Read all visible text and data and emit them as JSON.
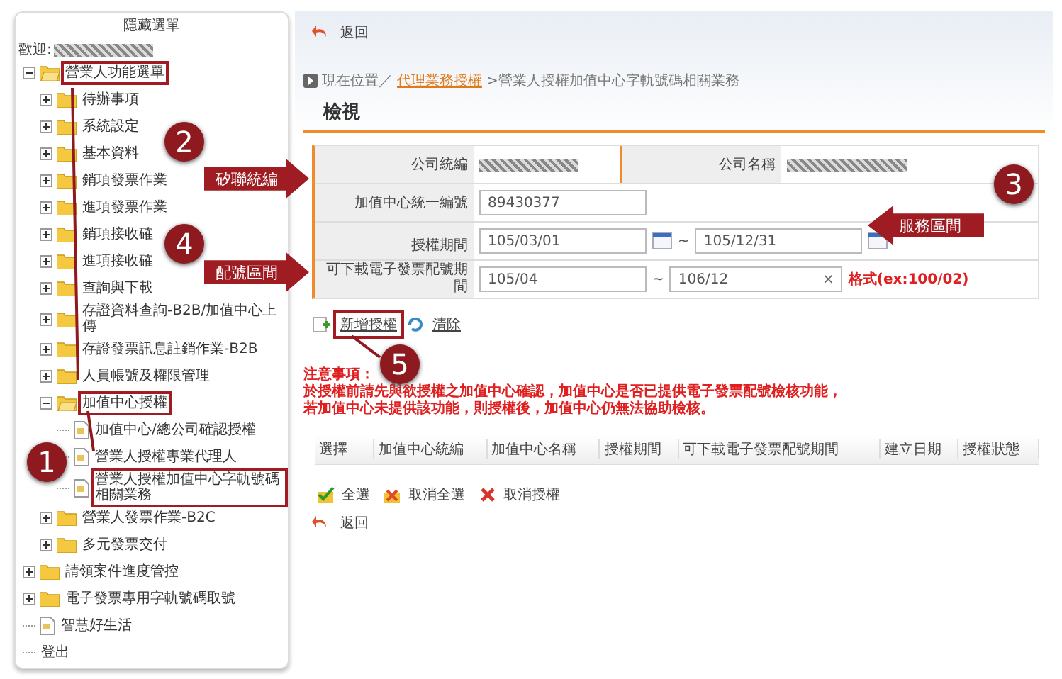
{
  "sidebar": {
    "title": "隱藏選單",
    "welcome": "歡迎:",
    "tree": [
      {
        "label": "營業人功能選單",
        "kind": "folder",
        "expanded": true,
        "marked": true,
        "children": [
          {
            "label": "待辦事項",
            "kind": "folder",
            "expanded": false
          },
          {
            "label": "系統設定",
            "kind": "folder",
            "expanded": false
          },
          {
            "label": "基本資料",
            "kind": "folder",
            "expanded": false
          },
          {
            "label": "銷項發票作業",
            "kind": "folder",
            "expanded": false
          },
          {
            "label": "進項發票作業",
            "kind": "folder",
            "expanded": false
          },
          {
            "label": "銷項接收確",
            "kind": "folder",
            "expanded": false
          },
          {
            "label": "進項接收確",
            "kind": "folder",
            "expanded": false
          },
          {
            "label": "查詢與下載",
            "kind": "folder",
            "expanded": false
          },
          {
            "label": "存證資料查詢-B2B/加值中心上傳",
            "kind": "folder",
            "expanded": false
          },
          {
            "label": "存證發票訊息註銷作業-B2B",
            "kind": "folder",
            "expanded": false
          },
          {
            "label": "人員帳號及權限管理",
            "kind": "folder",
            "expanded": false
          },
          {
            "label": "加值中心授權",
            "kind": "folder",
            "expanded": true,
            "marked": true,
            "children": [
              {
                "label": "加值中心/總公司確認授權",
                "kind": "file"
              },
              {
                "label": "營業人授權專業代理人",
                "kind": "file"
              },
              {
                "label": "營業人授權加值中心字軌號碼相關業務",
                "kind": "file",
                "marked": true
              }
            ]
          },
          {
            "label": "營業人發票作業-B2C",
            "kind": "folder",
            "expanded": false
          },
          {
            "label": "多元發票交付",
            "kind": "folder",
            "expanded": false
          }
        ]
      },
      {
        "label": "請領案件進度管控",
        "kind": "folder",
        "expanded": false
      },
      {
        "label": "電子發票專用字軌號碼取號",
        "kind": "folder",
        "expanded": false
      },
      {
        "label": "智慧好生活",
        "kind": "file"
      },
      {
        "label": "登出",
        "kind": "plain"
      }
    ]
  },
  "top_back": "返回",
  "breadcrumb": {
    "prefix": "現在位置／",
    "link": "代理業務授權",
    "current": ">營業人授權加值中心字軌號碼相關業務"
  },
  "tab": "檢視",
  "form": {
    "company_id_label": "公司統編",
    "company_name_label": "公司名稱",
    "vac_id_label": "加值中心統一編號",
    "vac_id": "89430377",
    "period_label": "授權期間",
    "period_from": "105/03/01",
    "period_to": "105/12/31",
    "download_label": "可下載電子發票配號期間",
    "download_from": "105/04",
    "download_to": "106/12",
    "format_hint": "格式(ex:100/02)",
    "tilde": "~",
    "clear_mark": "×"
  },
  "actions": [
    {
      "label": "新增授權",
      "kind": "add",
      "marked": true
    },
    {
      "label": "清除",
      "kind": "clear",
      "marked": false
    }
  ],
  "notice": {
    "title": "注意事項：",
    "lines": [
      "於授權前請先與欲授權之加值中心確認，加值中心是否已提供電子發票配號檢核功能，",
      "若加值中心未提供該功能，則授權後，加值中心仍無法協助檢核。"
    ]
  },
  "table": {
    "columns": [
      "選擇",
      "加值中心統編",
      "加值中心名稱",
      "授權期間",
      "可下載電子發票配號期間",
      "建立日期",
      "授權狀態"
    ]
  },
  "bottom_actions": [
    {
      "label": "全選",
      "kind": "check"
    },
    {
      "label": "取消全選",
      "kind": "uncheck"
    },
    {
      "label": "取消授權",
      "kind": "cancel"
    }
  ],
  "bottom_back": "返回",
  "badges": [
    "1",
    "2",
    "3",
    "4",
    "5"
  ],
  "callouts": [
    {
      "label": "矽聯統編",
      "kind": "right"
    },
    {
      "label": "服務區間",
      "kind": "left"
    },
    {
      "label": "配號區間",
      "kind": "right"
    }
  ]
}
